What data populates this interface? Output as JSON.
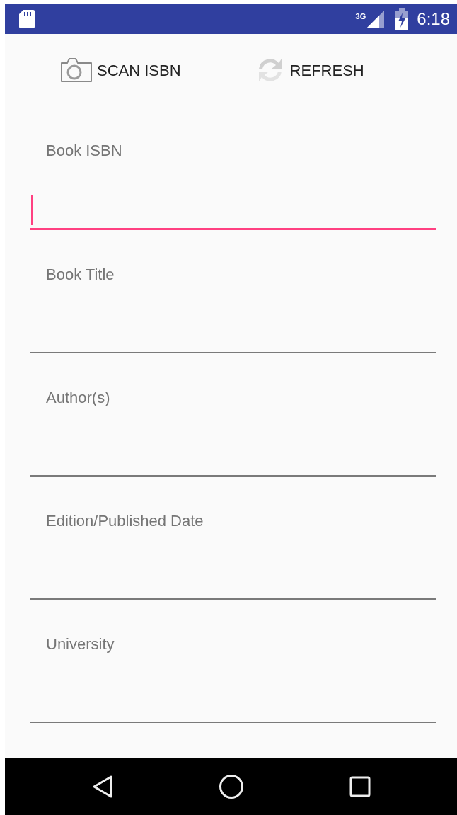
{
  "status_bar": {
    "network": "3G",
    "time": "6:18"
  },
  "actions": [
    {
      "kind": "camera",
      "label": "SCAN ISBN"
    },
    {
      "kind": "refresh",
      "label": "REFRESH"
    }
  ],
  "fields": [
    {
      "label": "Book ISBN",
      "focused": true
    },
    {
      "label": "Book Title",
      "focused": false
    },
    {
      "label": "Author(s)",
      "focused": false
    },
    {
      "label": "Edition/Published Date",
      "focused": false
    },
    {
      "label": "University",
      "focused": false
    }
  ]
}
